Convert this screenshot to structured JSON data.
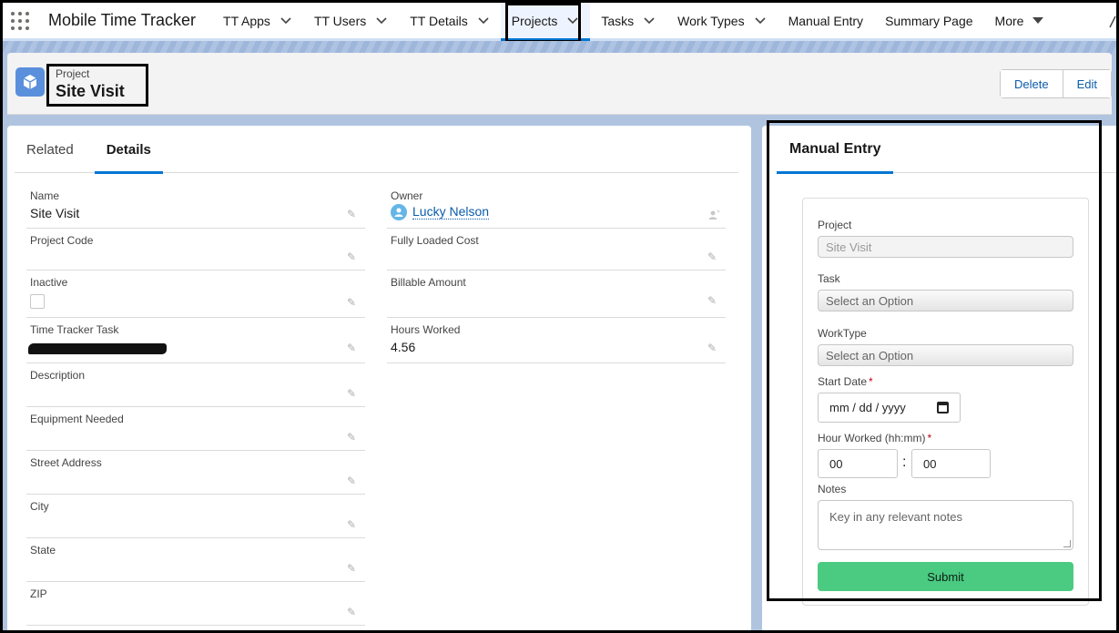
{
  "app": {
    "name": "Mobile Time Tracker"
  },
  "nav": {
    "items": [
      {
        "label": "TT Apps"
      },
      {
        "label": "TT Users"
      },
      {
        "label": "TT Details"
      },
      {
        "label": "Projects"
      },
      {
        "label": "Tasks"
      },
      {
        "label": "Work Types"
      },
      {
        "label": "Manual Entry"
      },
      {
        "label": "Summary Page"
      },
      {
        "label": "More"
      }
    ]
  },
  "header": {
    "object_type": "Project",
    "record_name": "Site Visit",
    "delete_label": "Delete",
    "edit_label": "Edit"
  },
  "detail_tabs": {
    "related": "Related",
    "details": "Details"
  },
  "fields": {
    "name": {
      "label": "Name",
      "value": "Site Visit"
    },
    "owner": {
      "label": "Owner",
      "value": "Lucky Nelson"
    },
    "project_code": {
      "label": "Project Code",
      "value": ""
    },
    "fully_loaded_cost": {
      "label": "Fully Loaded Cost",
      "value": ""
    },
    "inactive": {
      "label": "Inactive",
      "checked": false
    },
    "billable_amount": {
      "label": "Billable Amount",
      "value": ""
    },
    "time_tracker_task": {
      "label": "Time Tracker Task",
      "value": ""
    },
    "hours_worked": {
      "label": "Hours Worked",
      "value": "4.56"
    },
    "description": {
      "label": "Description",
      "value": ""
    },
    "equipment_needed": {
      "label": "Equipment Needed",
      "value": ""
    },
    "street_address": {
      "label": "Street Address",
      "value": ""
    },
    "city": {
      "label": "City",
      "value": ""
    },
    "state": {
      "label": "State",
      "value": ""
    },
    "zip": {
      "label": "ZIP",
      "value": ""
    }
  },
  "manual_entry": {
    "tab_label": "Manual Entry",
    "project": {
      "label": "Project",
      "value": "Site Visit"
    },
    "task": {
      "label": "Task",
      "placeholder": "Select an Option"
    },
    "work_type": {
      "label": "WorkType",
      "placeholder": "Select an Option"
    },
    "start_date": {
      "label": "Start Date",
      "required_mark": "*",
      "placeholder": "mm / dd / yyyy"
    },
    "hours": {
      "label": "Hour Worked (hh:mm)",
      "required_mark": "*",
      "hh": "00",
      "mm": "00",
      "separator": ":"
    },
    "notes": {
      "label": "Notes",
      "placeholder": "Key in any relevant notes"
    },
    "submit_label": "Submit"
  },
  "colors": {
    "brand_blue": "#0176d3",
    "submit_green": "#4bca81",
    "object_icon": "#5a8fdc"
  }
}
